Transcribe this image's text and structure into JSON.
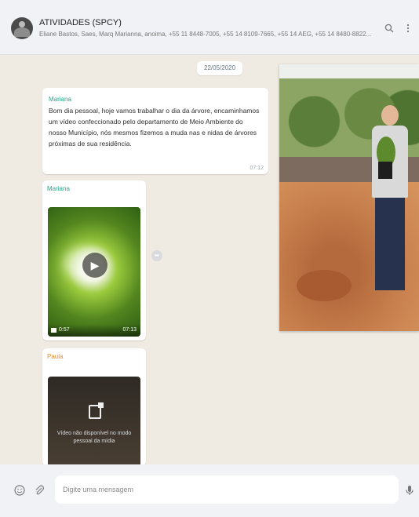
{
  "header": {
    "title": "ATIVIDADES (SPCY)",
    "members": "Eliane Bastos, Saes, Marq Marianna, anoima, +55 11 8448-7005, +55 14 8109-7665, +55 14 AEG, +55 14 8480-8822...",
    "icons": [
      "search-icon",
      "menu-icon"
    ]
  },
  "chat": {
    "date_label": "22/05/2020",
    "message1": {
      "sender": "Mariana",
      "text": "Bom dia pessoal, hoje vamos trabalhar o dia da árvore, encaminhamos um vídeo confeccionado pelo departamento de Meio Ambiente do nosso Município, nós mesmos fizemos a muda nas e nidas de árvores próximas de sua residência.",
      "time": "07:12"
    },
    "message2": {
      "sender": "Mariana",
      "duration": "0:57",
      "time": "07:13"
    },
    "message3": {
      "sender": "Paula",
      "video_status": "Vídeo não disponível no modo pessoal da mídia"
    },
    "colors": {
      "chat_background": "#efeae2",
      "sender_green": "#25a889",
      "sender_orange": "#e38a2c"
    }
  },
  "composer": {
    "placeholder": "Digite uma mensagem",
    "icons": [
      "emoji-icon",
      "attach-icon",
      "microphone-icon"
    ]
  }
}
